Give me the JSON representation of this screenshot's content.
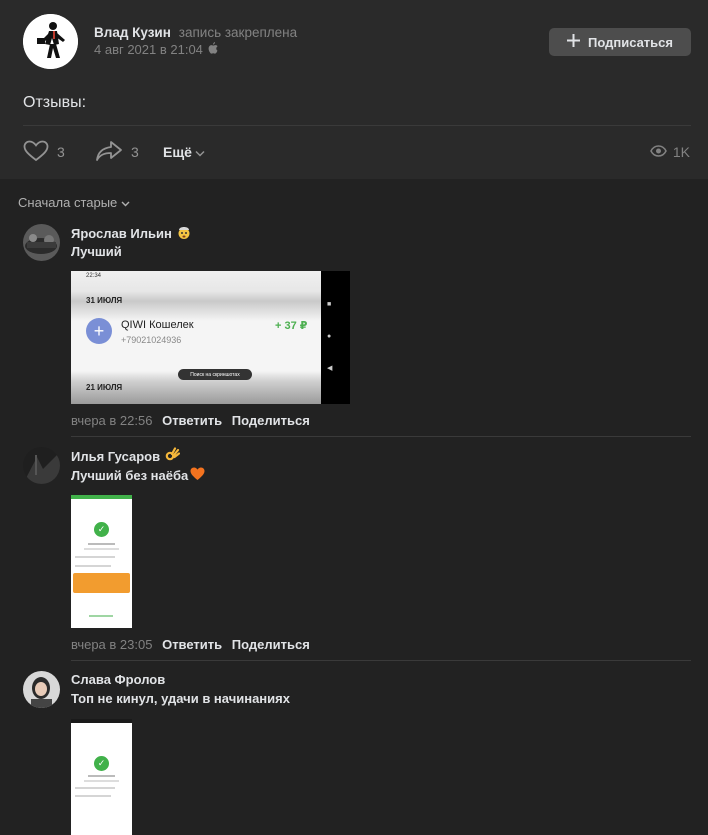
{
  "post": {
    "author": "Влад Кузин",
    "pinned": "запись закреплена",
    "date": "4 авг 2021 в 21:04",
    "subscribe_label": "Подписаться",
    "text": "Отзывы:",
    "likes": "3",
    "shares": "3",
    "more_label": "Ещё",
    "views": "1K"
  },
  "sort_label": "Сначала старые",
  "comments": [
    {
      "author": "Ярослав Ильин",
      "text": "Лучший",
      "time": "вчера в 22:56",
      "reply": "Ответить",
      "share": "Поделиться",
      "screenshot": {
        "status_time": "22:34",
        "date_top": "31 ИЮЛЯ",
        "wallet_name": "QIWI Кошелек",
        "wallet_phone": "+79021024936",
        "amount": "+ 37 ₽",
        "pill": "Поиск на скриншотах",
        "date_bottom": "21 ИЮЛЯ"
      }
    },
    {
      "author": "Илья Гусаров",
      "text": "Лучший без наёба",
      "time": "вчера в 23:05",
      "reply": "Ответить",
      "share": "Поделиться"
    },
    {
      "author": "Слава Фролов",
      "text": "Топ не кинул, удачи в начинаниях"
    }
  ],
  "colors": {
    "background": "#222222",
    "post_background": "#2a2a2a",
    "button": "#4d4d4d",
    "muted": "#828282",
    "text": "#e1e3e6"
  },
  "icons": {
    "like": "heart-icon",
    "share": "share-arrow-icon",
    "views": "eye-icon",
    "platform": "apple-icon",
    "chevron": "chevron-down-icon",
    "plus": "plus-icon"
  }
}
